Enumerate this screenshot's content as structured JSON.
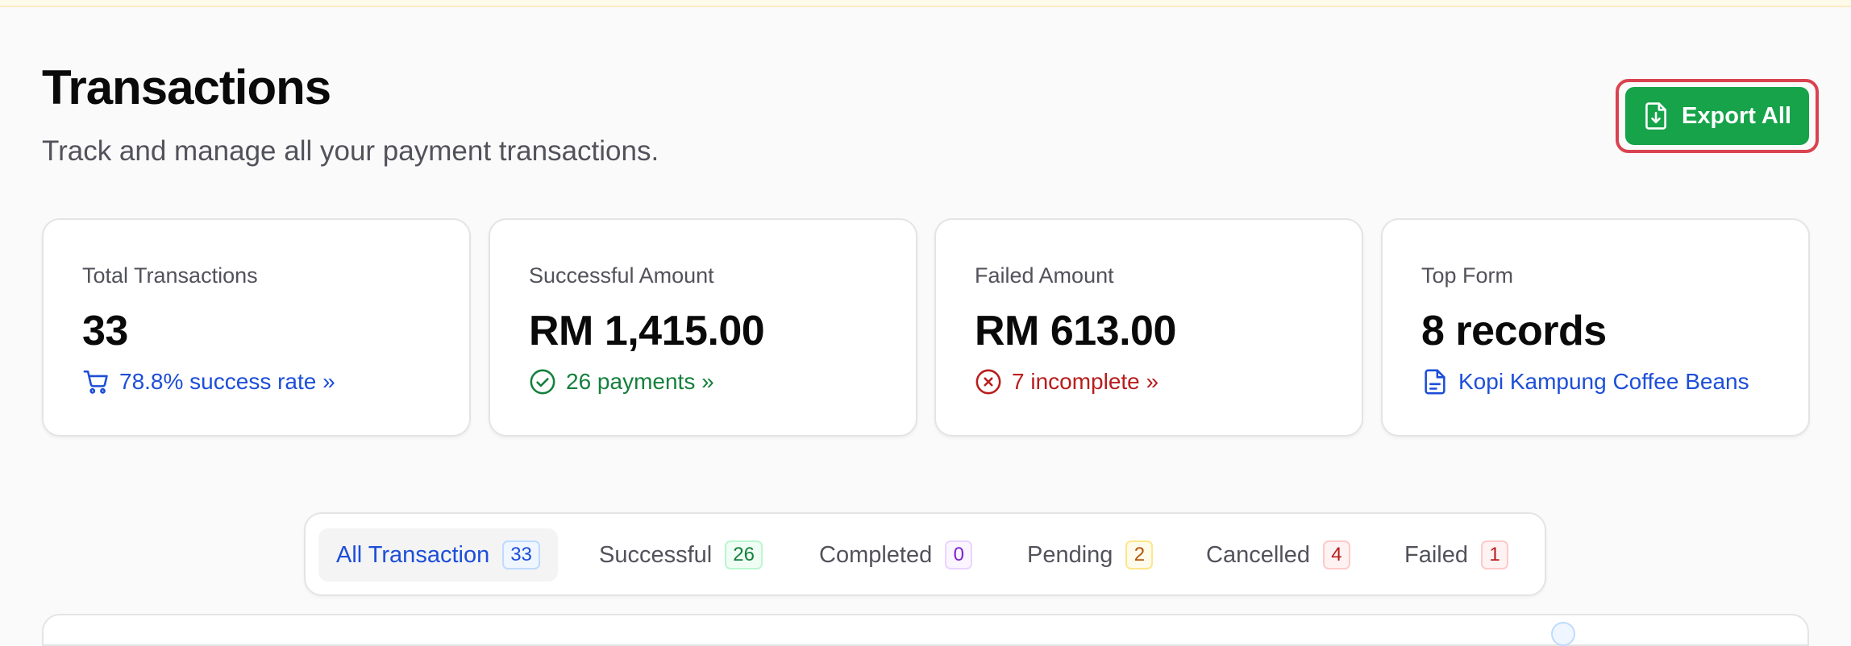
{
  "header": {
    "title": "Transactions",
    "subtitle": "Track and manage all your payment transactions.",
    "export_label": "Export All"
  },
  "stats": [
    {
      "label": "Total Transactions",
      "value": "33",
      "link": "78.8% success rate »",
      "icon": "cart-icon"
    },
    {
      "label": "Successful Amount",
      "value": "RM 1,415.00",
      "link": "26 payments »",
      "icon": "check-circle-icon"
    },
    {
      "label": "Failed Amount",
      "value": "RM 613.00",
      "link": "7 incomplete »",
      "icon": "x-circle-icon"
    },
    {
      "label": "Top Form",
      "value": "8 records",
      "link": "Kopi Kampung Coffee Beans",
      "icon": "file-text-icon"
    }
  ],
  "tabs": [
    {
      "label": "All Transaction",
      "count": "33"
    },
    {
      "label": "Successful",
      "count": "26"
    },
    {
      "label": "Completed",
      "count": "0"
    },
    {
      "label": "Pending",
      "count": "2"
    },
    {
      "label": "Cancelled",
      "count": "4"
    },
    {
      "label": "Failed",
      "count": "1"
    }
  ],
  "colors": {
    "accent_green": "#16a34a",
    "highlight_red": "#d9434f",
    "link_blue": "#1d4ed8",
    "success_green": "#15803d",
    "danger_red": "#b91c1c"
  }
}
